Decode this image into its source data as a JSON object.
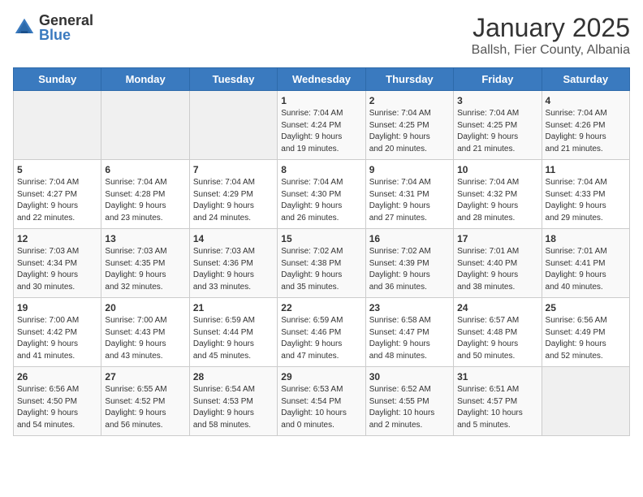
{
  "logo": {
    "general": "General",
    "blue": "Blue"
  },
  "title": "January 2025",
  "location": "Ballsh, Fier County, Albania",
  "days_header": [
    "Sunday",
    "Monday",
    "Tuesday",
    "Wednesday",
    "Thursday",
    "Friday",
    "Saturday"
  ],
  "weeks": [
    [
      {
        "day": "",
        "info": ""
      },
      {
        "day": "",
        "info": ""
      },
      {
        "day": "",
        "info": ""
      },
      {
        "day": "1",
        "info": "Sunrise: 7:04 AM\nSunset: 4:24 PM\nDaylight: 9 hours\nand 19 minutes."
      },
      {
        "day": "2",
        "info": "Sunrise: 7:04 AM\nSunset: 4:25 PM\nDaylight: 9 hours\nand 20 minutes."
      },
      {
        "day": "3",
        "info": "Sunrise: 7:04 AM\nSunset: 4:25 PM\nDaylight: 9 hours\nand 21 minutes."
      },
      {
        "day": "4",
        "info": "Sunrise: 7:04 AM\nSunset: 4:26 PM\nDaylight: 9 hours\nand 21 minutes."
      }
    ],
    [
      {
        "day": "5",
        "info": "Sunrise: 7:04 AM\nSunset: 4:27 PM\nDaylight: 9 hours\nand 22 minutes."
      },
      {
        "day": "6",
        "info": "Sunrise: 7:04 AM\nSunset: 4:28 PM\nDaylight: 9 hours\nand 23 minutes."
      },
      {
        "day": "7",
        "info": "Sunrise: 7:04 AM\nSunset: 4:29 PM\nDaylight: 9 hours\nand 24 minutes."
      },
      {
        "day": "8",
        "info": "Sunrise: 7:04 AM\nSunset: 4:30 PM\nDaylight: 9 hours\nand 26 minutes."
      },
      {
        "day": "9",
        "info": "Sunrise: 7:04 AM\nSunset: 4:31 PM\nDaylight: 9 hours\nand 27 minutes."
      },
      {
        "day": "10",
        "info": "Sunrise: 7:04 AM\nSunset: 4:32 PM\nDaylight: 9 hours\nand 28 minutes."
      },
      {
        "day": "11",
        "info": "Sunrise: 7:04 AM\nSunset: 4:33 PM\nDaylight: 9 hours\nand 29 minutes."
      }
    ],
    [
      {
        "day": "12",
        "info": "Sunrise: 7:03 AM\nSunset: 4:34 PM\nDaylight: 9 hours\nand 30 minutes."
      },
      {
        "day": "13",
        "info": "Sunrise: 7:03 AM\nSunset: 4:35 PM\nDaylight: 9 hours\nand 32 minutes."
      },
      {
        "day": "14",
        "info": "Sunrise: 7:03 AM\nSunset: 4:36 PM\nDaylight: 9 hours\nand 33 minutes."
      },
      {
        "day": "15",
        "info": "Sunrise: 7:02 AM\nSunset: 4:38 PM\nDaylight: 9 hours\nand 35 minutes."
      },
      {
        "day": "16",
        "info": "Sunrise: 7:02 AM\nSunset: 4:39 PM\nDaylight: 9 hours\nand 36 minutes."
      },
      {
        "day": "17",
        "info": "Sunrise: 7:01 AM\nSunset: 4:40 PM\nDaylight: 9 hours\nand 38 minutes."
      },
      {
        "day": "18",
        "info": "Sunrise: 7:01 AM\nSunset: 4:41 PM\nDaylight: 9 hours\nand 40 minutes."
      }
    ],
    [
      {
        "day": "19",
        "info": "Sunrise: 7:00 AM\nSunset: 4:42 PM\nDaylight: 9 hours\nand 41 minutes."
      },
      {
        "day": "20",
        "info": "Sunrise: 7:00 AM\nSunset: 4:43 PM\nDaylight: 9 hours\nand 43 minutes."
      },
      {
        "day": "21",
        "info": "Sunrise: 6:59 AM\nSunset: 4:44 PM\nDaylight: 9 hours\nand 45 minutes."
      },
      {
        "day": "22",
        "info": "Sunrise: 6:59 AM\nSunset: 4:46 PM\nDaylight: 9 hours\nand 47 minutes."
      },
      {
        "day": "23",
        "info": "Sunrise: 6:58 AM\nSunset: 4:47 PM\nDaylight: 9 hours\nand 48 minutes."
      },
      {
        "day": "24",
        "info": "Sunrise: 6:57 AM\nSunset: 4:48 PM\nDaylight: 9 hours\nand 50 minutes."
      },
      {
        "day": "25",
        "info": "Sunrise: 6:56 AM\nSunset: 4:49 PM\nDaylight: 9 hours\nand 52 minutes."
      }
    ],
    [
      {
        "day": "26",
        "info": "Sunrise: 6:56 AM\nSunset: 4:50 PM\nDaylight: 9 hours\nand 54 minutes."
      },
      {
        "day": "27",
        "info": "Sunrise: 6:55 AM\nSunset: 4:52 PM\nDaylight: 9 hours\nand 56 minutes."
      },
      {
        "day": "28",
        "info": "Sunrise: 6:54 AM\nSunset: 4:53 PM\nDaylight: 9 hours\nand 58 minutes."
      },
      {
        "day": "29",
        "info": "Sunrise: 6:53 AM\nSunset: 4:54 PM\nDaylight: 10 hours\nand 0 minutes."
      },
      {
        "day": "30",
        "info": "Sunrise: 6:52 AM\nSunset: 4:55 PM\nDaylight: 10 hours\nand 2 minutes."
      },
      {
        "day": "31",
        "info": "Sunrise: 6:51 AM\nSunset: 4:57 PM\nDaylight: 10 hours\nand 5 minutes."
      },
      {
        "day": "",
        "info": ""
      }
    ]
  ]
}
